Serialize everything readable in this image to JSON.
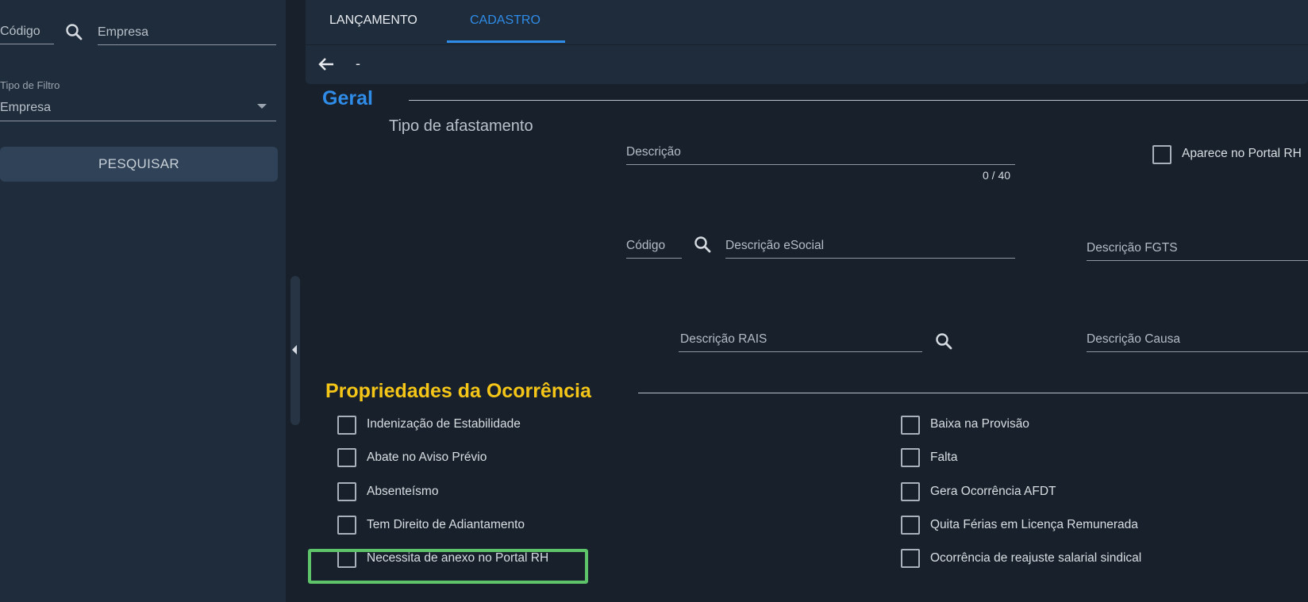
{
  "sidebar": {
    "codigo_label": "Código",
    "empresa_label": "Empresa",
    "tipo_filtro_label": "Tipo de Filtro",
    "tipo_filtro_value": "Empresa",
    "search_button": "PESQUISAR"
  },
  "tabs": [
    "LANÇAMENTO",
    "CADASTRO"
  ],
  "active_tab": "CADASTRO",
  "subbar": {
    "record_title": "-"
  },
  "geral": {
    "title": "Geral",
    "subtitle": "Tipo de afastamento",
    "descricao_label": "Descrição",
    "descricao_counter": "0 / 40",
    "portal_rh_label": "Aparece no Portal RH",
    "codigo_label": "Código",
    "descricao_esocial_label": "Descrição eSocial",
    "descricao_fgts_label": "Descrição FGTS",
    "descricao_rais_label": "Descrição RAIS",
    "descricao_causa_label": "Descrição Causa"
  },
  "propriedades": {
    "title": "Propriedades da Ocorrência",
    "left": [
      "Indenização de Estabilidade",
      "Abate no Aviso Prévio",
      "Absenteísmo",
      "Tem Direito de Adiantamento",
      "Necessita de anexo no Portal RH"
    ],
    "right": [
      "Baixa na Provisão",
      "Falta",
      "Gera Ocorrência AFDT",
      "Quita Férias em Licença Remunerada",
      "Ocorrência de reajuste salarial sindical"
    ]
  },
  "colors": {
    "accent_blue": "#2f8ce8",
    "accent_yellow": "#f5c518",
    "highlight_green": "#5dc46a"
  }
}
